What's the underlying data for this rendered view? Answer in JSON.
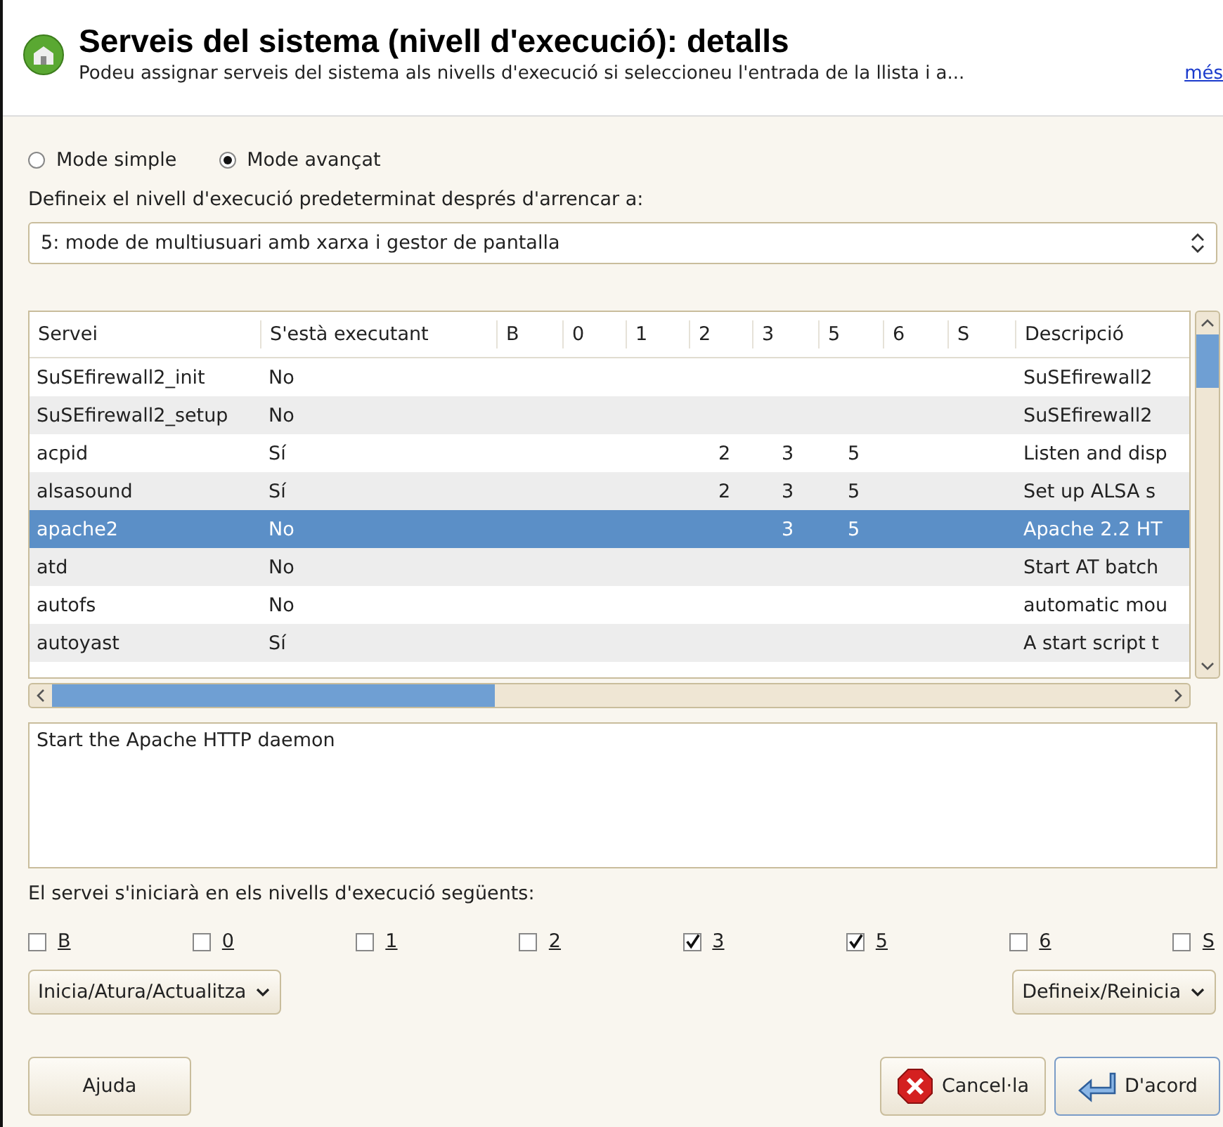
{
  "header": {
    "title": "Serveis del sistema (nivell d'execució): detalls",
    "subtitle": "Podeu assignar serveis del sistema als nivells d'execució si seleccioneu l'entrada de la llista i a...",
    "more_link": "més"
  },
  "modes": [
    {
      "label": "Mode simple",
      "selected": false
    },
    {
      "label": "Mode avançat",
      "selected": true
    }
  ],
  "default_runlevel": {
    "label": "Defineix el nivell d'execució predeterminat després d'arrencar a:",
    "value": "5: mode de multiusuari amb xarxa i gestor de pantalla"
  },
  "table": {
    "columns": [
      "Servei",
      "S'està executant",
      "B",
      "0",
      "1",
      "2",
      "3",
      "5",
      "6",
      "S",
      "Descripció"
    ],
    "rows": [
      {
        "service": "SuSEfirewall2_init",
        "running": "No",
        "levels": [],
        "description": "SuSEfirewall2",
        "selected": false
      },
      {
        "service": "SuSEfirewall2_setup",
        "running": "No",
        "levels": [],
        "description": "SuSEfirewall2",
        "selected": false
      },
      {
        "service": "acpid",
        "running": "Sí",
        "levels": [
          "2",
          "3",
          "5"
        ],
        "description": "Listen and disp",
        "selected": false
      },
      {
        "service": "alsasound",
        "running": "Sí",
        "levels": [
          "2",
          "3",
          "5"
        ],
        "description": "Set up ALSA s",
        "selected": false
      },
      {
        "service": "apache2",
        "running": "No",
        "levels": [
          "3",
          "5"
        ],
        "description": "Apache 2.2 HT",
        "selected": true
      },
      {
        "service": "atd",
        "running": "No",
        "levels": [],
        "description": "Start AT batch",
        "selected": false
      },
      {
        "service": "autofs",
        "running": "No",
        "levels": [],
        "description": "automatic mou",
        "selected": false
      },
      {
        "service": "autoyast",
        "running": "Sí",
        "levels": [],
        "description": "A start script t",
        "selected": false
      }
    ]
  },
  "description_box": "Start the Apache HTTP daemon",
  "levels_label": "El servei s'iniciarà en els nivells d'execució següents:",
  "level_checks": [
    {
      "label": "B",
      "checked": false
    },
    {
      "label": "0",
      "checked": false
    },
    {
      "label": "1",
      "checked": false
    },
    {
      "label": "2",
      "checked": false
    },
    {
      "label": "3",
      "checked": true
    },
    {
      "label": "5",
      "checked": true
    },
    {
      "label": "6",
      "checked": false
    },
    {
      "label": "S",
      "checked": false
    }
  ],
  "action_menus": [
    "Inicia/Atura/Actualitza",
    "Defineix/Reinicia"
  ],
  "buttons": {
    "help": "Ajuda",
    "cancel": "Cancel·la",
    "ok": "D'acord"
  }
}
